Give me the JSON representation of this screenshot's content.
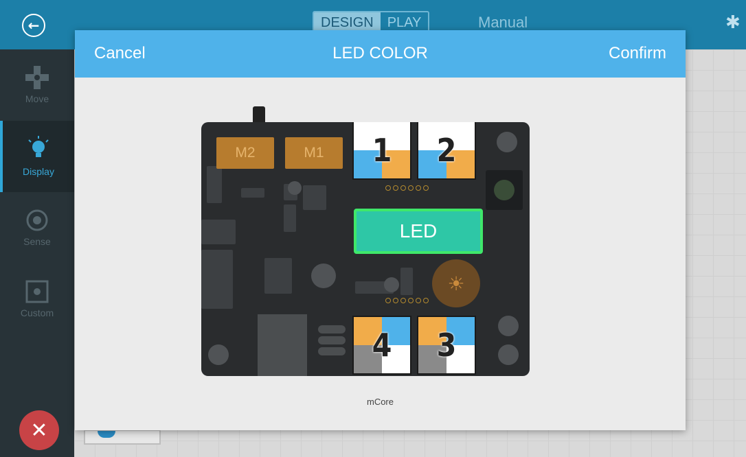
{
  "app": {
    "mode_design": "DESIGN",
    "mode_play": "PLAY",
    "manual_label": "Manual",
    "sidebar": [
      {
        "label": "Move",
        "icon": "gamepad-icon"
      },
      {
        "label": "Display",
        "icon": "bulb-icon"
      },
      {
        "label": "Sense",
        "icon": "sensor-icon"
      },
      {
        "label": "Custom",
        "icon": "custom-icon"
      }
    ],
    "close_icon": "close-icon"
  },
  "dialog": {
    "cancel": "Cancel",
    "title": "LED COLOR",
    "confirm": "Confirm",
    "caption": "mCore"
  },
  "board": {
    "motors": [
      "M2",
      "M1"
    ],
    "rgb_leds": [
      {
        "number": "1",
        "colors": [
          "#ffffff",
          "#ffffff",
          "#4fb2ea",
          "#f1ac4a"
        ]
      },
      {
        "number": "2",
        "colors": [
          "#ffffff",
          "#ffffff",
          "#4fb2ea",
          "#f1ac4a"
        ]
      },
      {
        "number": "4",
        "colors": [
          "#f1ac4a",
          "#4fb2ea",
          "#8a8a8a",
          "#ffffff"
        ]
      },
      {
        "number": "3",
        "colors": [
          "#f1ac4a",
          "#4fb2ea",
          "#8a8a8a",
          "#ffffff"
        ]
      }
    ],
    "led_label": "LED"
  },
  "colors": {
    "header_blue": "#4fb2ea",
    "led_green": "#2ec7a6",
    "led_border": "#3fe86a",
    "motor_orange": "#b77c2e",
    "close_red": "#c84346"
  }
}
